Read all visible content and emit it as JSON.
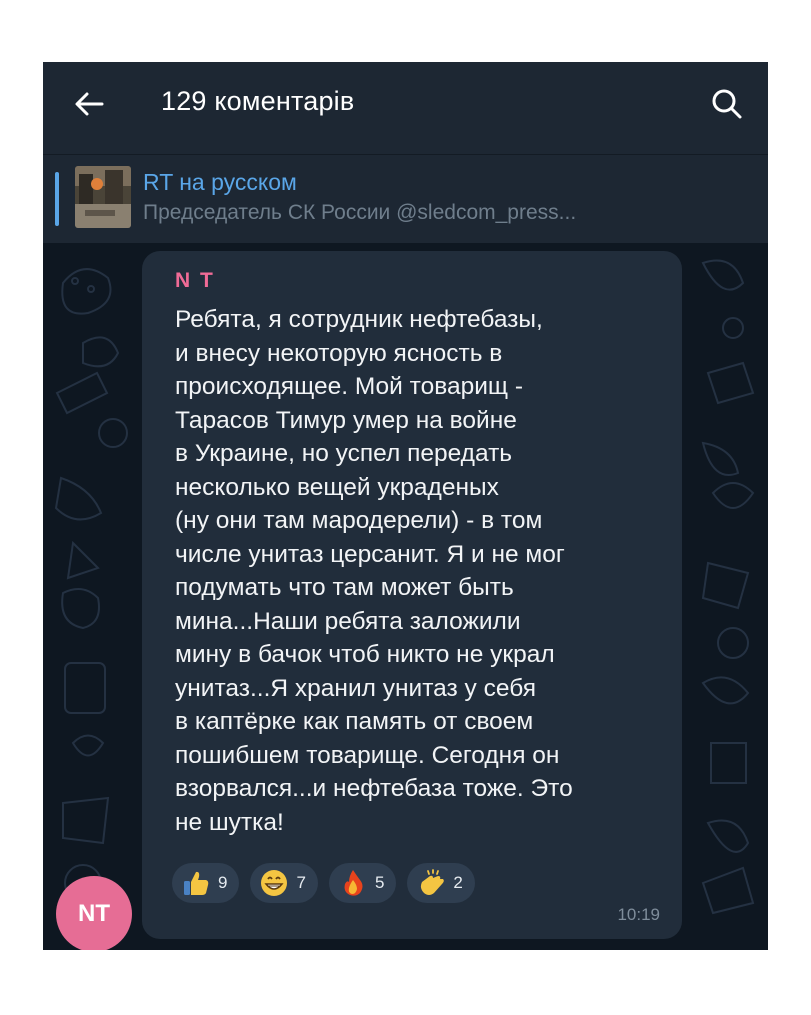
{
  "header": {
    "title": "129 коментарів",
    "back_icon": "arrow-left-icon",
    "search_icon": "search-icon"
  },
  "pinned": {
    "channel": "RT на русском",
    "text": "Председатель СК России @sledcom_press..."
  },
  "message": {
    "sender": "N T",
    "lines": [
      "Ребята, я сотрудник нефтебазы,",
      "и внесу некоторую ясность в",
      "происходящее. Мой товарищ -",
      "Тарасов Тимур умер на войне",
      "в Украине, но успел передать",
      "несколько вещей украденых",
      "(ну они там мародерели) - в том",
      "числе унитаз церсанит. Я и не мог",
      "подумать что там может быть",
      "мина...Наши ребята заложили",
      "мину в бачок чтоб никто не украл",
      "унитаз...Я хранил унитаз у себя",
      "в каптёрке как память от своем",
      "пошибшем товарище. Сегодня он",
      "взорвался...и нефтебаза тоже. Это",
      "не шутка!"
    ],
    "time": "10:19",
    "avatar_initials": "NT",
    "reactions": [
      {
        "emoji": "thumbs-up-icon",
        "count": "9"
      },
      {
        "emoji": "grinning-face-icon",
        "count": "7"
      },
      {
        "emoji": "fire-icon",
        "count": "5"
      },
      {
        "emoji": "clapping-hands-icon",
        "count": "2"
      }
    ]
  },
  "colors": {
    "header_bg": "#1d2733",
    "chat_bg": "#0e1721",
    "bubble_bg": "#212d3b",
    "accent_blue": "#5aa6e8",
    "sender_pink": "#f06b96",
    "avatar_bg": "#e66d95"
  }
}
